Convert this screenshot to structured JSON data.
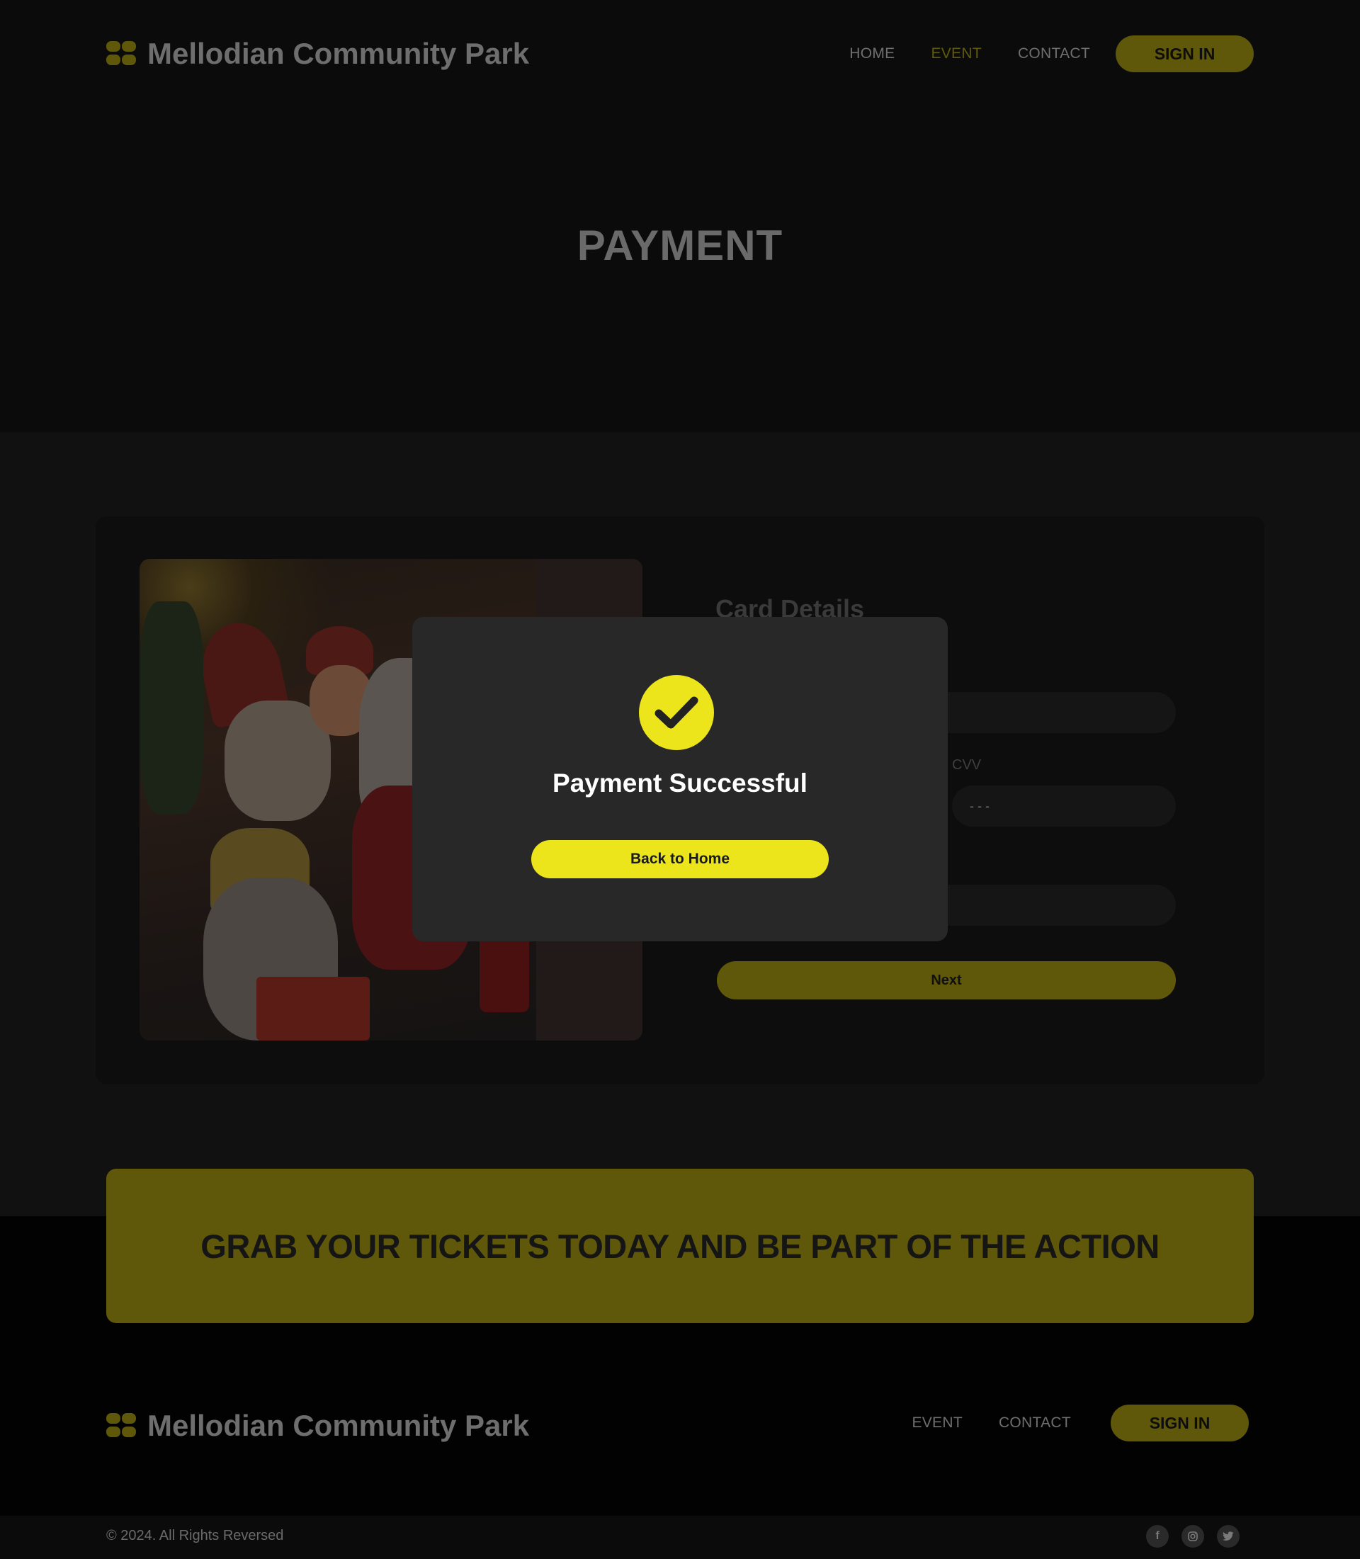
{
  "brand": {
    "name": "Mellodian Community Park",
    "logo_icon": "ticket-icon"
  },
  "nav": {
    "home": "HOME",
    "event": "EVENT",
    "contact": "CONTACT",
    "signin": "SIGN IN",
    "active": "EVENT"
  },
  "page": {
    "title": "PAYMENT"
  },
  "form": {
    "title": "Card Details",
    "cvv_label": "CVV",
    "cvv_placeholder": "- - -",
    "next_label": "Next"
  },
  "modal": {
    "icon": "check-icon",
    "title": "Payment Successful",
    "button_label": "Back to Home"
  },
  "cta": {
    "text": "GRAB YOUR TICKETS TODAY AND BE PART OF THE ACTION"
  },
  "footer": {
    "nav": {
      "event": "EVENT",
      "contact": "CONTACT",
      "signin": "SIGN IN"
    },
    "copyright": "© 2024. All Rights Reversed",
    "socials": [
      "facebook-icon",
      "instagram-icon",
      "twitter-icon"
    ]
  },
  "colors": {
    "accent": "#ece51b",
    "accent_dimmed": "#5f5709",
    "background": "#0b0b0b",
    "modal": "#282828"
  }
}
